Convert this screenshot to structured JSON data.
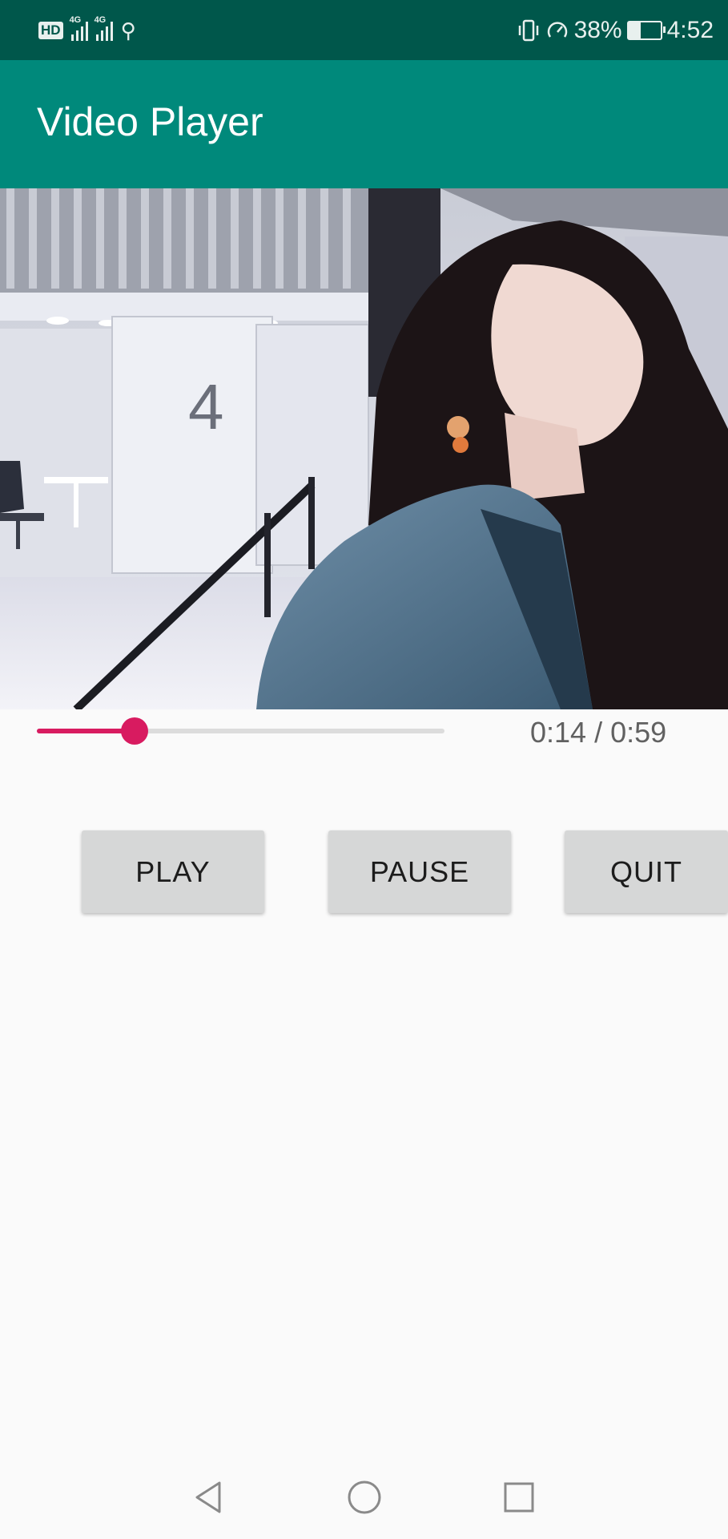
{
  "status_bar": {
    "hd": "HD",
    "network_1": "4G",
    "network_2": "4G",
    "battery_percent": "38%",
    "time": "4:52",
    "battery_level": 0.38
  },
  "toolbar": {
    "title": "Video Player"
  },
  "player": {
    "time_display": "0:14 / 0:59",
    "progress_fraction": 0.24
  },
  "controls": {
    "play_label": "PLAY",
    "pause_label": "PAUSE",
    "quit_label": "QUIT"
  },
  "theme": {
    "status_bar_color": "#00574b",
    "toolbar_color": "#00897b",
    "accent_color": "#d81b60",
    "button_color": "#d6d7d7"
  },
  "nav": {
    "back_icon": "back-triangle",
    "home_icon": "home-circle",
    "recents_icon": "recents-square"
  }
}
